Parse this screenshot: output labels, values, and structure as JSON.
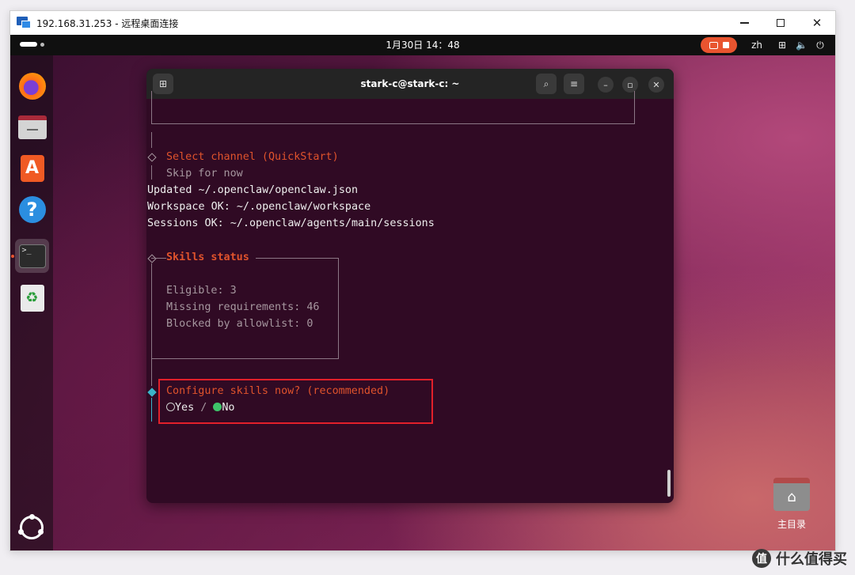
{
  "rdp": {
    "title": "192.168.31.253 - 远程桌面连接"
  },
  "topbar": {
    "clock": "1月30日  14：48",
    "input_method": "zh",
    "icons": [
      "screen-share-icon",
      "network-icon",
      "volume-icon",
      "power-icon"
    ]
  },
  "dock": {
    "items": [
      "firefox-icon",
      "files-icon",
      "app-center-icon",
      "help-icon",
      "terminal-icon",
      "trash-icon",
      "show-apps-icon"
    ],
    "terminal_glyph": ">_"
  },
  "desktop": {
    "home_folder_label": "主目录"
  },
  "terminal": {
    "title": "stark-c@stark-c: ~",
    "lines": {
      "select_channel": "Select channel (QuickStart)",
      "skip": "Skip for now",
      "updated": "Updated ~/.openclaw/openclaw.json",
      "workspace": "Workspace OK: ~/.openclaw/workspace",
      "sessions": "Sessions OK: ~/.openclaw/agents/main/sessions",
      "skills_status": "Skills status",
      "eligible": "Eligible: 3",
      "missing": "Missing requirements: 46",
      "blocked": "Blocked by allowlist: 0",
      "configure_prompt": "Configure skills now? (recommended)",
      "option_yes": "Yes",
      "separator": " / ",
      "option_no": "No"
    },
    "selected_option": "No"
  },
  "watermark": {
    "text": "什么值得买",
    "glyph": "值"
  }
}
